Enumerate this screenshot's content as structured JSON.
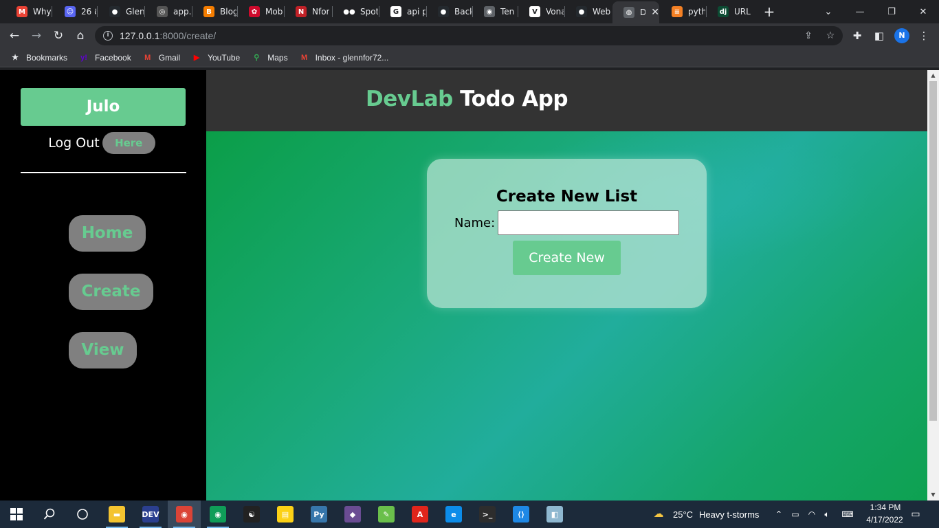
{
  "browser": {
    "tabs": [
      {
        "title": "Why",
        "icon": "gmail-icon",
        "color": "#ea4335",
        "glyph": "M"
      },
      {
        "title": "26 &",
        "icon": "discord-icon",
        "color": "#5865f2",
        "glyph": "☺"
      },
      {
        "title": "Glen",
        "icon": "github-icon",
        "color": "#24292e",
        "glyph": "●"
      },
      {
        "title": "app.b",
        "icon": "heroku-icon",
        "color": "#555555",
        "glyph": "◎"
      },
      {
        "title": "Blogg",
        "icon": "blogger-icon",
        "color": "#f57d00",
        "glyph": "B"
      },
      {
        "title": "Mobi",
        "icon": "huawei-icon",
        "color": "#cf0a2c",
        "glyph": "✿"
      },
      {
        "title": "Nfor",
        "icon": "nest-icon",
        "color": "#c12127",
        "glyph": "N"
      },
      {
        "title": "Spoti",
        "icon": "medium-icon",
        "color": "#202124",
        "glyph": "●●"
      },
      {
        "title": "api p",
        "icon": "google-icon",
        "color": "#ffffff",
        "glyph": "G"
      },
      {
        "title": "Back",
        "icon": "github-icon",
        "color": "#24292e",
        "glyph": "●"
      },
      {
        "title": "Ten In",
        "icon": "incognito-icon",
        "color": "#5f6368",
        "glyph": "◉"
      },
      {
        "title": "Vona",
        "icon": "vonage-icon",
        "color": "#ffffff",
        "glyph": "V"
      },
      {
        "title": "Web",
        "icon": "github-icon",
        "color": "#24292e",
        "glyph": "●"
      },
      {
        "title": "D",
        "icon": "globe-icon",
        "color": "#5f6368",
        "glyph": "◍",
        "active": true
      },
      {
        "title": "pytho",
        "icon": "stackoverflow-icon",
        "color": "#f48024",
        "glyph": "≡"
      },
      {
        "title": "URL c",
        "icon": "django-icon",
        "color": "#0c4b33",
        "glyph": "dj"
      }
    ],
    "new_tab_label": "+",
    "window_controls": {
      "dropdown": "⌄",
      "minimize": "—",
      "restore": "❐",
      "close": "✕"
    },
    "address": {
      "host": "127.0.0.1",
      "path": ":8000/create/"
    },
    "profile_initial": "N",
    "bookmarks": [
      {
        "label": "Bookmarks",
        "icon": "star-icon",
        "color": "#e8eaed",
        "glyph": "★"
      },
      {
        "label": "Facebook",
        "icon": "yahoo-icon",
        "color": "#6001d2",
        "glyph": "y!"
      },
      {
        "label": "Gmail",
        "icon": "gmail-icon",
        "color": "#ea4335",
        "glyph": "M"
      },
      {
        "label": "YouTube",
        "icon": "youtube-icon",
        "color": "#ff0000",
        "glyph": "▶"
      },
      {
        "label": "Maps",
        "icon": "maps-icon",
        "color": "#34a853",
        "glyph": "⚲"
      },
      {
        "label": "Inbox - glennfor72...",
        "icon": "gmail-icon",
        "color": "#ea4335",
        "glyph": "M"
      }
    ]
  },
  "sidebar": {
    "username": "Julo",
    "logout_text": "Log Out",
    "logout_button": "Here",
    "nav": [
      {
        "label": "Home"
      },
      {
        "label": "Create"
      },
      {
        "label": "View"
      }
    ]
  },
  "header": {
    "brand": "DevLab",
    "title_rest": "Todo App"
  },
  "form": {
    "title": "Create New List",
    "name_label": "Name:",
    "name_value": "",
    "submit_label": "Create New"
  },
  "colors": {
    "accent": "#67cb90",
    "header_bg": "#333333",
    "sidebar_bg": "#000000",
    "button_gray": "#808080"
  },
  "taskbar": {
    "apps": [
      {
        "icon": "file-explorer-icon",
        "color": "#f4c430",
        "glyph": "▬"
      },
      {
        "icon": "dev-app-icon",
        "color": "#2b3f8f",
        "glyph": "DEV"
      },
      {
        "icon": "chrome-icon",
        "color": "#db4437",
        "glyph": "◉",
        "active": true
      },
      {
        "icon": "chrome-icon",
        "color": "#0f9d58",
        "glyph": "◉"
      },
      {
        "icon": "yin-yang-icon",
        "color": "#222222",
        "glyph": "☯"
      },
      {
        "icon": "sticky-notes-icon",
        "color": "#fcd116",
        "glyph": "▤"
      },
      {
        "icon": "python-icon",
        "color": "#3776ab",
        "glyph": "Py"
      },
      {
        "icon": "git-kraken-icon",
        "color": "#6a4c93",
        "glyph": "◆"
      },
      {
        "icon": "notepad-icon",
        "color": "#6abf4b",
        "glyph": "✎"
      },
      {
        "icon": "acrobat-icon",
        "color": "#e0251b",
        "glyph": "A"
      },
      {
        "icon": "edge-icon",
        "color": "#0c8ce9",
        "glyph": "e"
      },
      {
        "icon": "terminal-icon",
        "color": "#2d2d2d",
        "glyph": ">_"
      },
      {
        "icon": "vscode-icon",
        "color": "#1e88e5",
        "glyph": "⟨⟩"
      },
      {
        "icon": "app-icon",
        "color": "#8fb8d0",
        "glyph": "◧"
      }
    ],
    "weather_temp": "25°C",
    "weather_desc": "Heavy t-storms",
    "time": "1:34 PM",
    "date": "4/17/2022"
  }
}
